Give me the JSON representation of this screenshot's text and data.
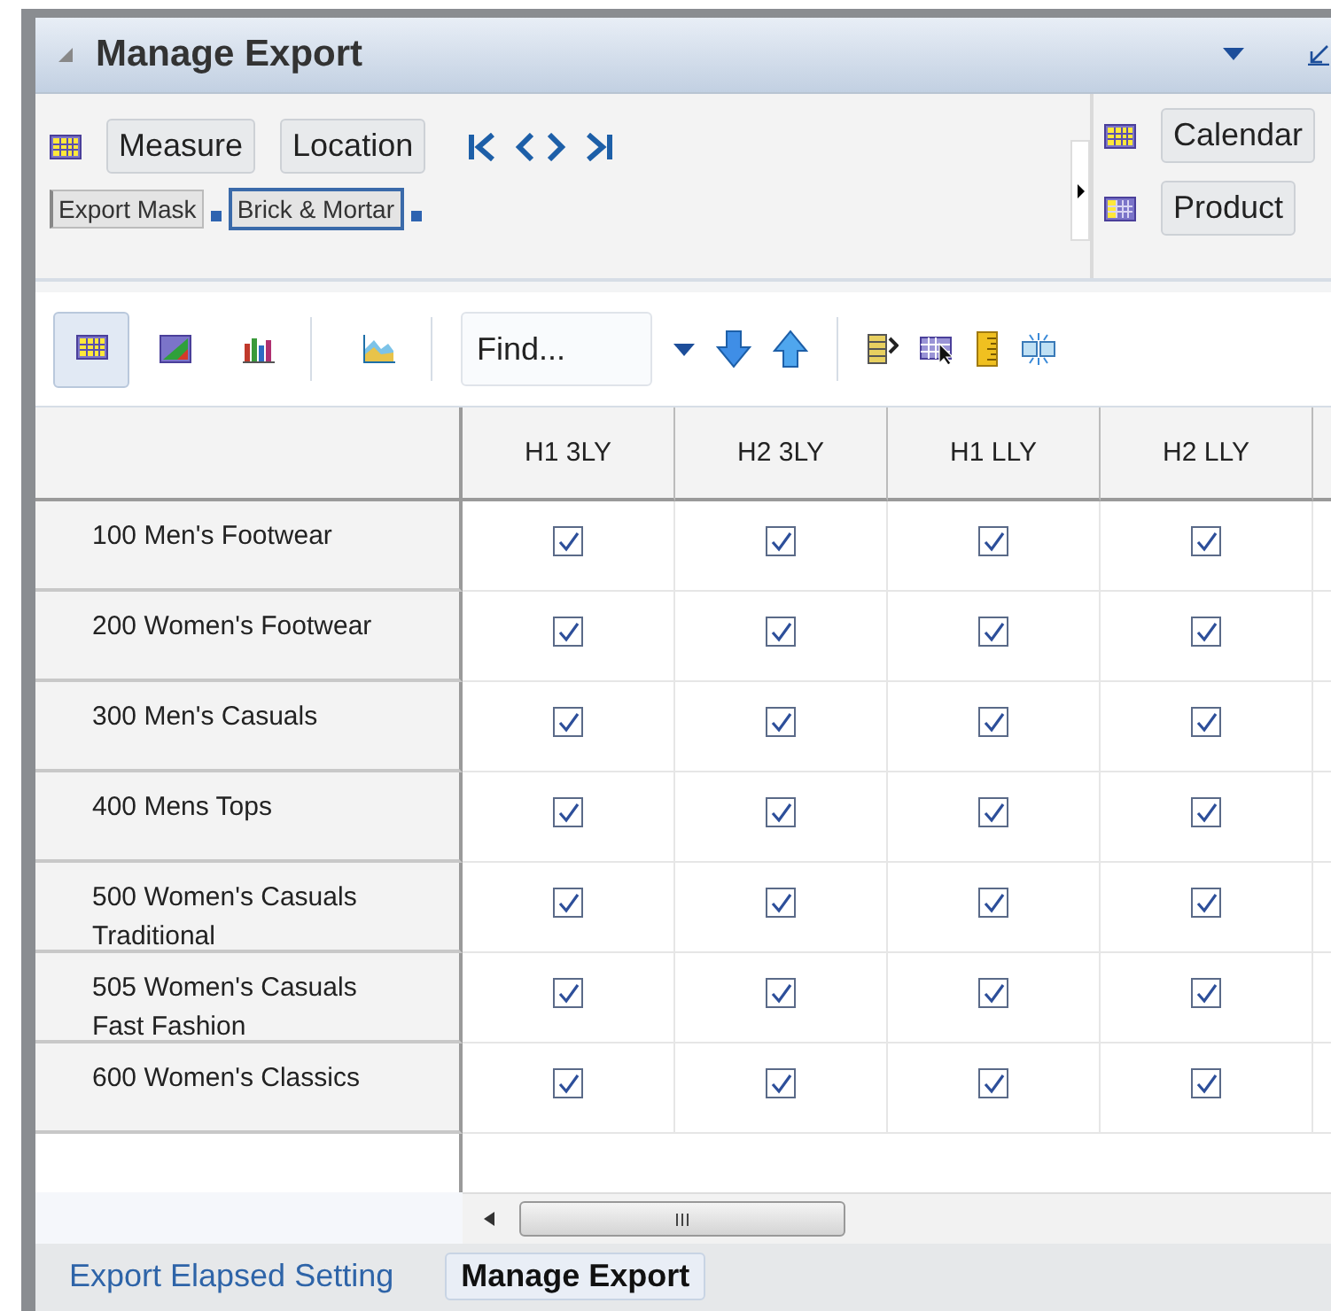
{
  "panel": {
    "title": "Manage Export"
  },
  "tiles": {
    "left": [
      "Measure",
      "Location"
    ],
    "right": [
      "Calendar",
      "Product"
    ]
  },
  "masks": [
    {
      "label": "Export Mask",
      "selected": false
    },
    {
      "label": "Brick & Mortar",
      "selected": true
    }
  ],
  "view_buttons": [
    {
      "kind": "grid",
      "selected": true
    },
    {
      "kind": "gridchart",
      "selected": false
    },
    {
      "kind": "bar",
      "selected": false
    },
    {
      "kind": "area",
      "selected": false
    }
  ],
  "find": {
    "placeholder": "Find..."
  },
  "table": {
    "columns": [
      "H1 3LY",
      "H2 3LY",
      "H1 LLY",
      "H2 LLY"
    ],
    "rows": [
      {
        "label": "100 Men's Footwear",
        "checked": [
          true,
          true,
          true,
          true
        ]
      },
      {
        "label": "200 Women's Footwear",
        "checked": [
          true,
          true,
          true,
          true
        ]
      },
      {
        "label": "300 Men's Casuals",
        "checked": [
          true,
          true,
          true,
          true
        ]
      },
      {
        "label": "400 Mens Tops",
        "checked": [
          true,
          true,
          true,
          true
        ]
      },
      {
        "label": "500 Women's Casuals Traditional",
        "checked": [
          true,
          true,
          true,
          true
        ]
      },
      {
        "label": "505 Women's Casuals Fast Fashion",
        "checked": [
          true,
          true,
          true,
          true
        ]
      },
      {
        "label": "600 Women's Classics",
        "checked": [
          true,
          true,
          true,
          true
        ]
      }
    ]
  },
  "bottom_tabs": [
    {
      "label": "Export Elapsed Setting",
      "selected": false
    },
    {
      "label": "Manage Export",
      "selected": true
    }
  ]
}
